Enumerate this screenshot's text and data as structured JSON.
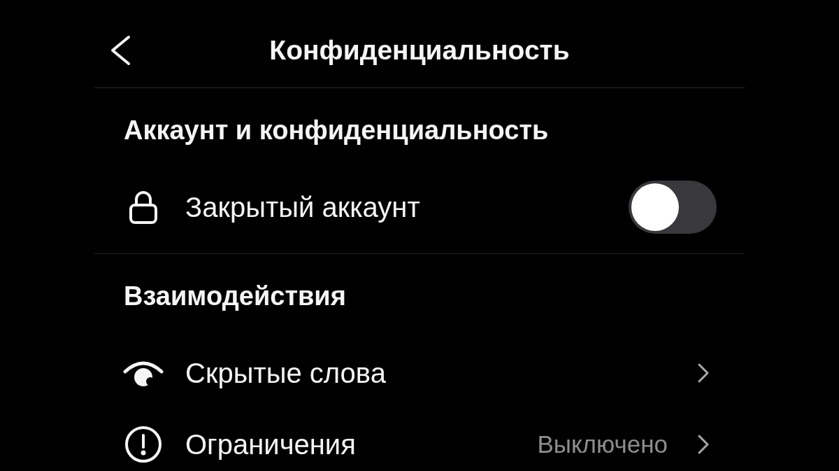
{
  "header": {
    "title": "Конфиденциальность"
  },
  "sections": [
    {
      "title": "Аккаунт и конфиденциальность",
      "items": [
        {
          "kind": "toggle",
          "label": "Закрытый аккаунт",
          "on": false
        }
      ]
    },
    {
      "title": "Взаимодействия",
      "items": [
        {
          "kind": "link",
          "label": "Скрытые слова"
        },
        {
          "kind": "link",
          "label": "Ограничения",
          "value": "Выключено"
        }
      ]
    }
  ]
}
